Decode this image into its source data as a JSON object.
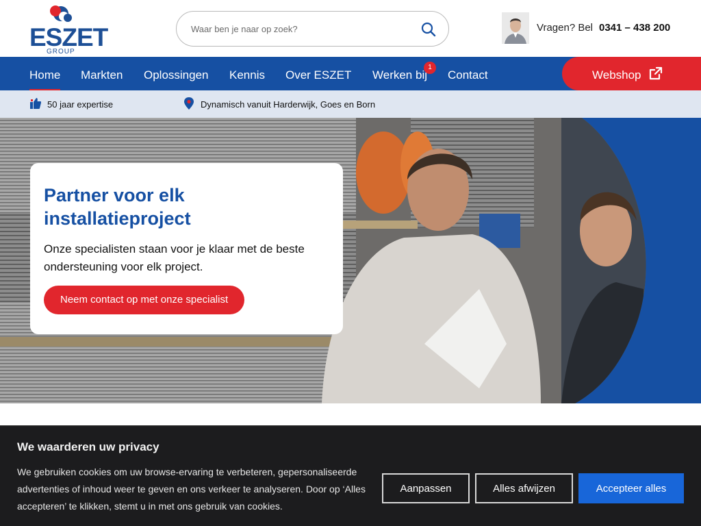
{
  "header": {
    "logo_text": "ESZET",
    "logo_sub": "GROUP",
    "search": {
      "placeholder": "Waar ben je naar op zoek?"
    },
    "contact_prompt": "Vragen? Bel",
    "phone": "0341 – 438 200"
  },
  "nav": {
    "items": [
      {
        "label": "Home",
        "active": true
      },
      {
        "label": "Markten"
      },
      {
        "label": "Oplossingen"
      },
      {
        "label": "Kennis"
      },
      {
        "label": "Over ESZET"
      },
      {
        "label": "Werken bij",
        "badge": "1"
      },
      {
        "label": "Contact"
      }
    ],
    "webshop_label": "Webshop"
  },
  "usp": [
    {
      "icon": "thumbs-up-icon",
      "text": "50 jaar expertise"
    },
    {
      "icon": "location-pin-icon",
      "text": "Dynamisch vanuit Harderwijk, Goes en Born"
    }
  ],
  "hero": {
    "title": "Partner voor elk installatieproject",
    "text": "Onze specialisten staan voor je klaar met de beste ondersteuning voor elk project.",
    "cta": "Neem contact op met onze specialist"
  },
  "cookie": {
    "title": "We waarderen uw privacy",
    "text": "We gebruiken cookies om uw browse-ervaring te verbeteren, gepersonaliseerde advertenties of inhoud weer te geven en ons verkeer te analyseren. Door op ‘Alles accepteren’ te klikken, stemt u in met ons gebruik van cookies.",
    "customize": "Aanpassen",
    "reject": "Alles afwijzen",
    "accept": "Accepteer alles"
  },
  "colors": {
    "brand_blue": "#1650a3",
    "brand_red": "#e1262d",
    "accept_blue": "#1866d9",
    "usp_bg": "#dfe6f1",
    "cookie_bg": "#1c1c1e"
  }
}
